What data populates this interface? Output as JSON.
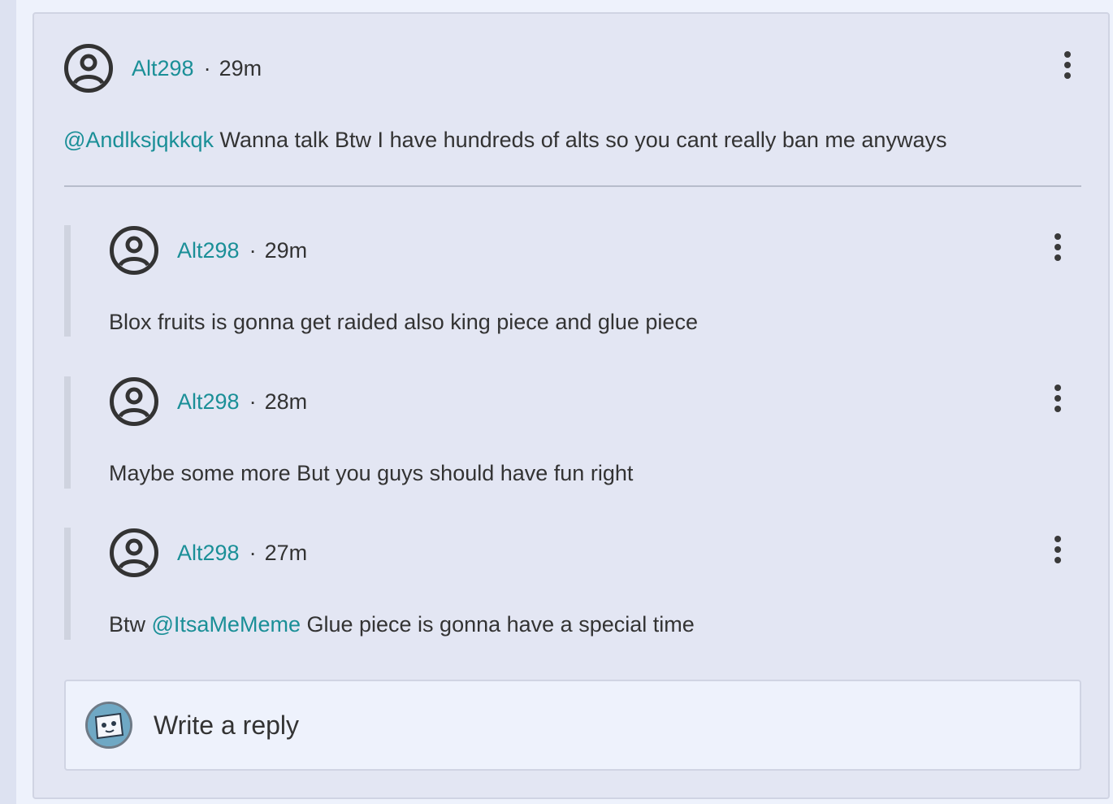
{
  "main_comment": {
    "username": "Alt298",
    "separator": "·",
    "time": "29m",
    "mention": "@Andlksjqkkqk",
    "text": " Wanna talk Btw I have hundreds of alts so you cant really ban me anyways"
  },
  "replies": [
    {
      "username": "Alt298",
      "separator": "·",
      "time": "29m",
      "text": "Blox fruits is gonna get raided also king piece and glue piece"
    },
    {
      "username": "Alt298",
      "separator": "·",
      "time": "28m",
      "text": "Maybe some more But you guys should have fun right"
    },
    {
      "username": "Alt298",
      "separator": "·",
      "time": "27m",
      "text_prefix": "Btw ",
      "mention": "@ItsaMeMeme",
      "text_suffix": " Glue piece is gonna have a special time"
    }
  ],
  "reply_box": {
    "placeholder": "Write a reply"
  },
  "icons": {
    "avatar": "user-circle-icon",
    "menu": "more-vertical-icon"
  },
  "colors": {
    "accent": "#1a8f97",
    "card_background": "#e3e6f3",
    "page_background": "#eef2fc",
    "text": "#333333"
  }
}
